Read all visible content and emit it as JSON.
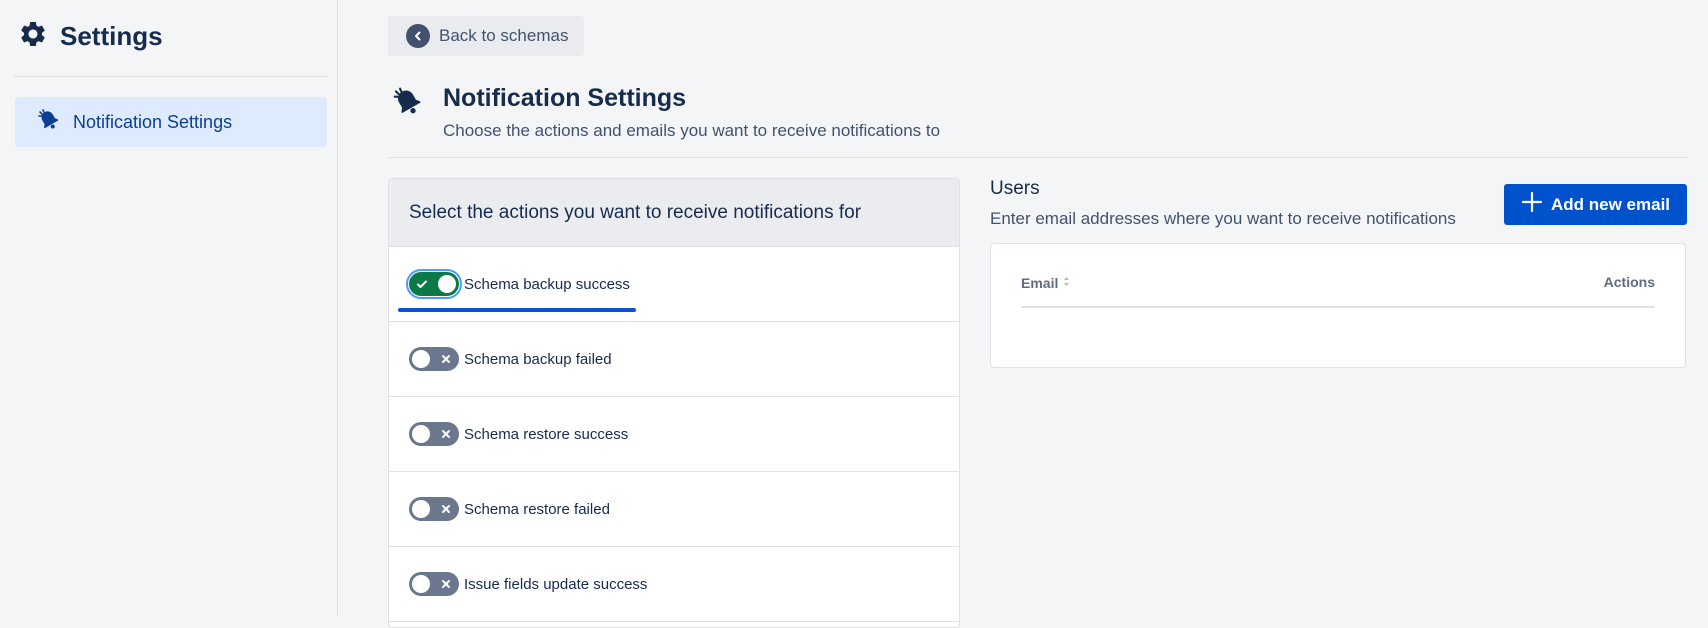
{
  "sidebar": {
    "title": "Settings",
    "icon": "gear-icon",
    "items": [
      {
        "label": "Notification Settings",
        "icon": "bell-icon",
        "active": true
      }
    ]
  },
  "back_button": {
    "label": "Back to schemas",
    "icon": "chevron-left-icon"
  },
  "page": {
    "icon": "bell-icon",
    "title": "Notification Settings",
    "subtitle": "Choose the actions and emails you want to receive notifications to"
  },
  "actions_panel": {
    "title": "Select the actions you want to receive notifications for",
    "items": [
      {
        "label": "Schema backup success",
        "enabled": true
      },
      {
        "label": "Schema backup failed",
        "enabled": false
      },
      {
        "label": "Schema restore success",
        "enabled": false
      },
      {
        "label": "Schema restore failed",
        "enabled": false
      },
      {
        "label": "Issue fields update success",
        "enabled": false
      }
    ]
  },
  "users_panel": {
    "title": "Users",
    "subtitle": "Enter email addresses where you want to receive notifications",
    "add_button": {
      "label": "Add new email",
      "icon": "plus-icon"
    },
    "table": {
      "columns": [
        "Email",
        "Actions"
      ],
      "rows": []
    }
  },
  "colors": {
    "brand": "#0052cc",
    "toggle_on": "#0b7a47",
    "toggle_off": "#6b778c",
    "active_nav_bg": "#deebff",
    "focus": "#0b4fd9"
  }
}
